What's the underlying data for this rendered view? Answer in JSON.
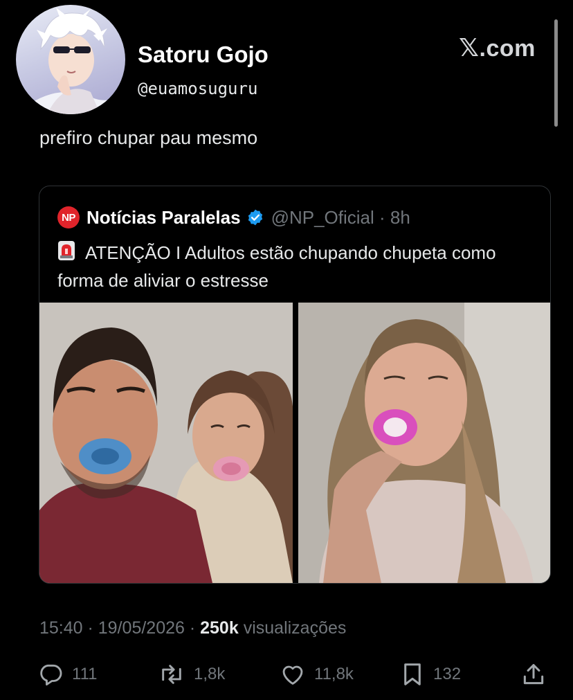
{
  "post": {
    "author_name": "Satoru Gojo",
    "author_handle": "@euamosuguru",
    "brand": ".com",
    "text": "prefiro chupar pau mesmo",
    "time": "15:40",
    "date": "19/05/2026",
    "views_count": "250k",
    "views_label": "visualizações"
  },
  "quoted": {
    "logo_text": "NP",
    "name": "Notícias Paralelas",
    "handle": "@NP_Oficial",
    "age": "8h",
    "text": "ATENÇÃO I Adultos estão chupando chupeta como forma de aliviar o estresse"
  },
  "actions": {
    "replies": "111",
    "reposts": "1,8k",
    "likes": "11,8k",
    "bookmarks": "132"
  },
  "icons": [
    "avatar",
    "x-logo",
    "verified-icon",
    "siren-icon",
    "reply-icon",
    "repost-icon",
    "like-icon",
    "bookmark-icon",
    "share-icon"
  ],
  "colors": {
    "background": "#000000",
    "text": "#e7e9ea",
    "muted": "#71767b",
    "verified": "#1d9bf0",
    "np_red": "#e0242b"
  }
}
